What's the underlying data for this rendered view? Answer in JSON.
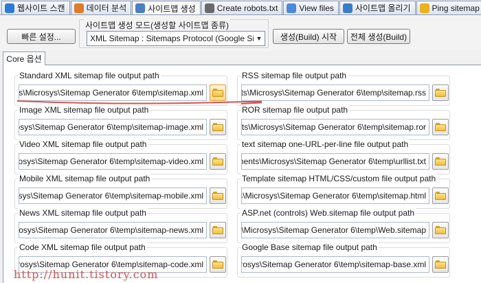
{
  "tabs": [
    {
      "label": "웹사이트 스캔",
      "icon": "magnifier-icon",
      "color": "#2e7bd6",
      "active": false
    },
    {
      "label": "데이터 분석",
      "icon": "pie-chart-icon",
      "color": "#e07b2a",
      "active": false
    },
    {
      "label": "사이트맵 생성",
      "icon": "sitemap-icon",
      "color": "#4a7fc1",
      "active": true
    },
    {
      "label": "Create robots.txt",
      "icon": "robot-icon",
      "color": "#6a6a6a",
      "active": false
    },
    {
      "label": "View files",
      "icon": "files-icon",
      "color": "#4a8ad8",
      "active": false
    },
    {
      "label": "사이트맵 올리기",
      "icon": "upload-icon",
      "color": "#3a7cc9",
      "active": false
    },
    {
      "label": "Ping sitemap",
      "icon": "lightning-icon",
      "color": "#e8b31c",
      "active": false
    }
  ],
  "toolbar": {
    "quick_setup": "빠른 설정...",
    "mode_legend": "사이트맵 생성 모드(생성할 사이트맵 종류)",
    "mode_value": "XML Sitemap : Sitemaps Protocol (Google Sitem",
    "build_start": "생성(Build) 시작",
    "build_all": "전체 생성(Build)"
  },
  "core_tab": "Core 옵션",
  "outputs_left": [
    {
      "label": "Standard XML sitemap file output path",
      "value": "ts\\Microsys\\Sitemap Generator 6\\temp\\sitemap.xml"
    },
    {
      "label": "Image XML sitemap file output path",
      "value": "rosys\\Sitemap Generator 6\\temp\\sitemap-image.xml"
    },
    {
      "label": "Video XML sitemap file output path",
      "value": "crosys\\Sitemap Generator 6\\temp\\sitemap-video.xml"
    },
    {
      "label": "Mobile XML sitemap file output path",
      "value": "osys\\Sitemap Generator 6\\temp\\sitemap-mobile.xml"
    },
    {
      "label": "News XML sitemap file output path",
      "value": "crosys\\Sitemap Generator 6\\temp\\sitemap-news.xml"
    },
    {
      "label": "Code XML sitemap file output path",
      "value": "crosys\\Sitemap Generator 6\\temp\\sitemap-code.xml"
    }
  ],
  "outputs_right": [
    {
      "label": "RSS sitemap file output path",
      "value": "nts\\Microsys\\Sitemap Generator 6\\temp\\sitemap.rss"
    },
    {
      "label": "ROR sitemap file output path",
      "value": "nts\\Microsys\\Sitemap Generator 6\\temp\\sitemap.ror"
    },
    {
      "label": "text sitemap one-URL-per-line file output path",
      "value": "nents\\Microsys\\Sitemap Generator 6\\temp\\urllist.txt"
    },
    {
      "label": "Template sitemap HTML/CSS/custom file output path",
      "value": "s\\Microsys\\Sitemap Generator 6\\temp\\sitemap.html"
    },
    {
      "label": "ASP.net (controls) Web.sitemap file output path",
      "value": "s\\Microsys\\Sitemap Generator 6\\temp\\Web.sitemap"
    },
    {
      "label": "Google Base sitemap file output path",
      "value": "icrosys\\Sitemap Generator 6\\temp\\sitemap-base.xml"
    }
  ],
  "watermark": "http://hunit.tistory.com",
  "colors": {
    "annotation": "#d9534f",
    "folder": "#f2bf3e"
  }
}
